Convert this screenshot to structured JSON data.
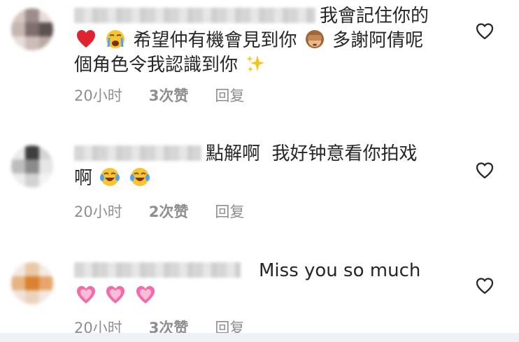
{
  "comments": [
    {
      "text_line1": "我會記住你的",
      "text_line2a": "希望仲有機會見到你",
      "text_line2b": "多謝阿倩呢",
      "text_line3": "個角色令我認識到你",
      "time": "20小时",
      "likes": "3次赞",
      "reply": "回复"
    },
    {
      "text_line1": "點解啊  我好钟意看你拍戏",
      "text_line2": "啊",
      "time": "20小时",
      "likes": "2次赞",
      "reply": "回复"
    },
    {
      "text_line1": "Miss you so much",
      "time": "20小时",
      "likes": "3次赞",
      "reply": "回复"
    }
  ],
  "icons": {
    "like": "heart-outline-icon",
    "emoji": [
      "red-heart-emoji",
      "crying-face-emoji",
      "see-no-evil-monkey-emoji",
      "sparkles-emoji",
      "tears-of-joy-emoji",
      "growing-heart-emoji"
    ]
  },
  "colors": {
    "text": "#262626",
    "meta": "#8e8e8e",
    "bottom_bar": "#eef2f6"
  }
}
